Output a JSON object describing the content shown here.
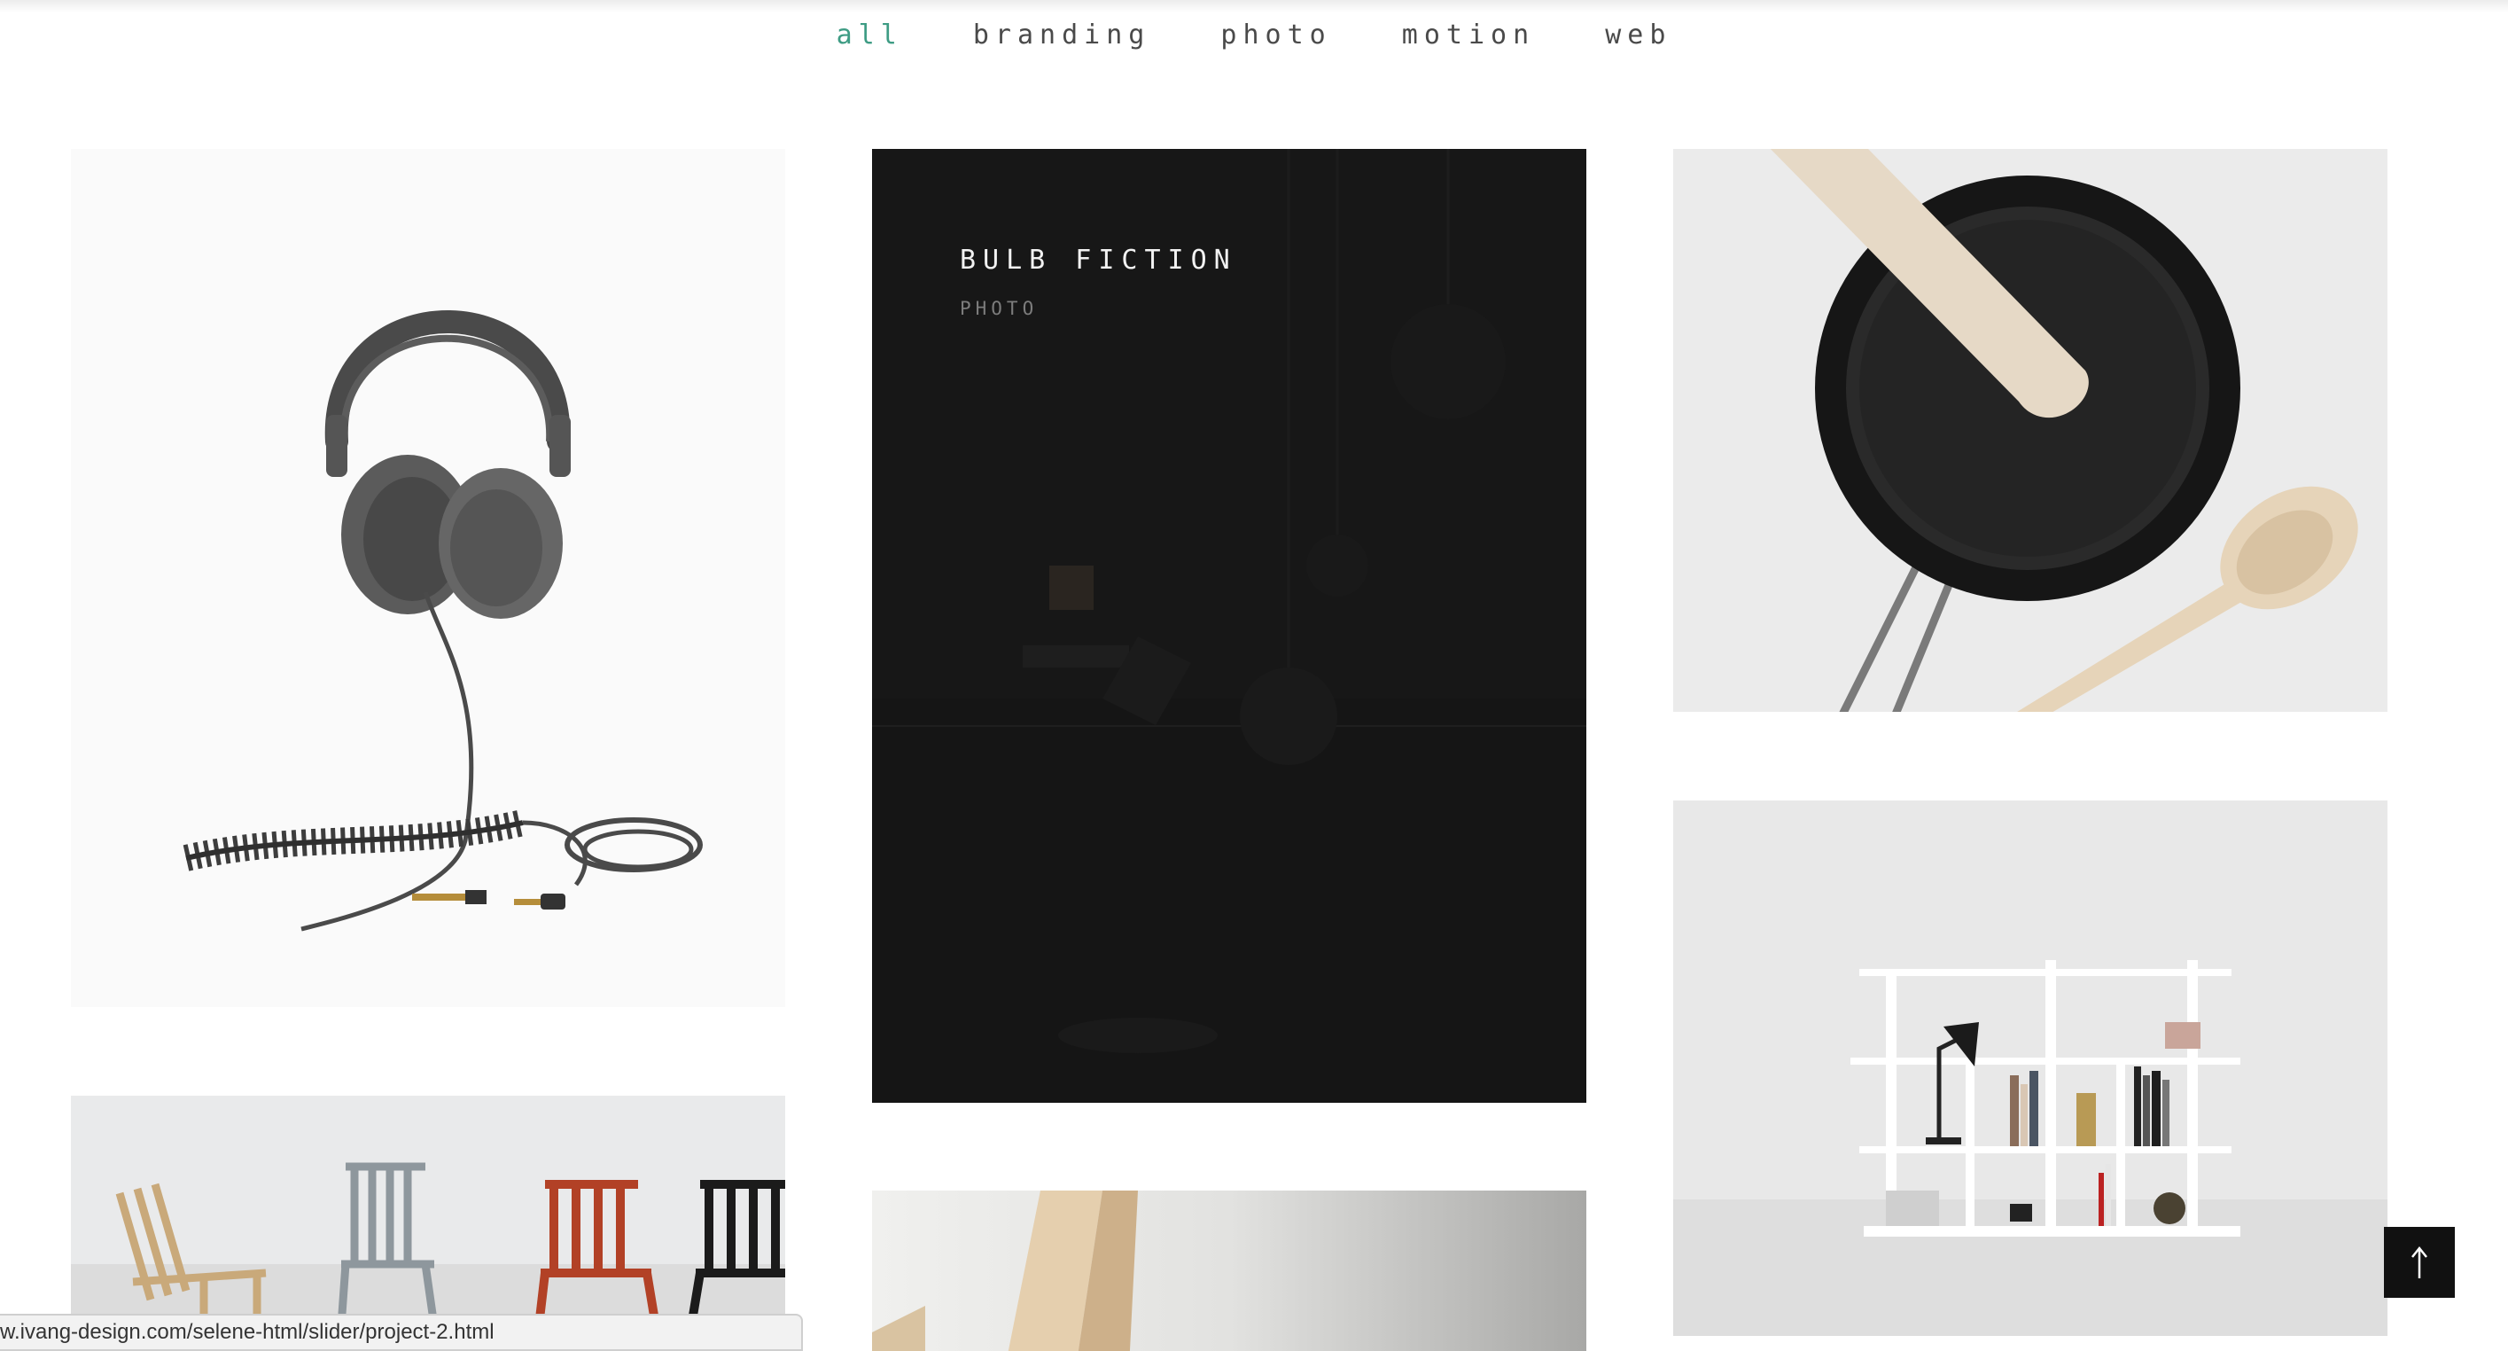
{
  "filters": {
    "items": [
      {
        "label": "all"
      },
      {
        "label": "branding"
      },
      {
        "label": "photo"
      },
      {
        "label": "motion"
      },
      {
        "label": "web"
      }
    ]
  },
  "projects": {
    "featured": {
      "title": "BULB FICTION",
      "category": "PHOTO"
    }
  },
  "status_bar": {
    "url": "w.ivang-design.com/selene-html/slider/project-2.html"
  },
  "colors": {
    "accent": "#3e9c84",
    "nav_text": "#4a4a4a",
    "overlay_bg": "#161616",
    "back_to_top_bg": "#111111"
  }
}
